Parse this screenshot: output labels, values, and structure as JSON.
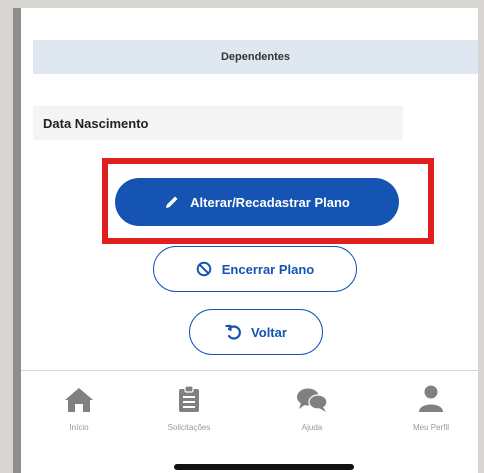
{
  "dependents": {
    "title": "Dependentes",
    "field_label": "Data Nascimento"
  },
  "actions": {
    "primary_label": "Alterar/Recadastrar Plano",
    "cancel_label": "Encerrar Plano",
    "back_label": "Voltar"
  },
  "tabbar": {
    "items": [
      {
        "label": "Início",
        "icon": "home-icon"
      },
      {
        "label": "Solicitações",
        "icon": "clipboard-icon"
      },
      {
        "label": "Ajuda",
        "icon": "chat-bubbles-icon"
      },
      {
        "label": "Meu Perfil",
        "icon": "user-icon"
      }
    ]
  },
  "colors": {
    "accent": "#1554b3",
    "highlight": "#e02020",
    "tab_icon": "#808080"
  }
}
